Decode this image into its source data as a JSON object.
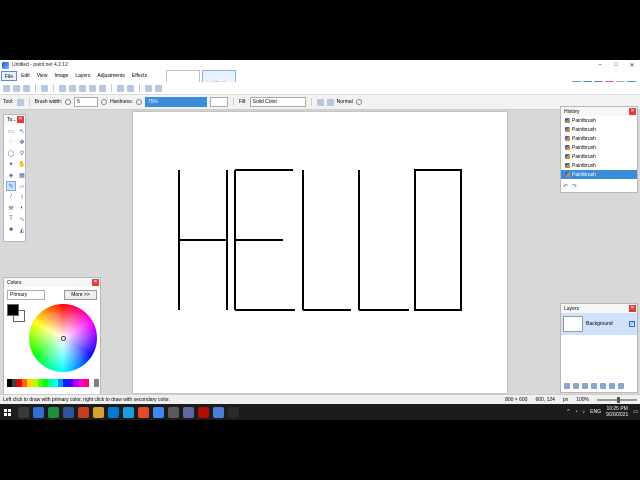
{
  "window": {
    "title": "Untitled - paint.net 4.2.12",
    "controls": [
      "–",
      "□",
      "✕"
    ]
  },
  "menu": [
    "File",
    "Edit",
    "View",
    "Image",
    "Layers",
    "Adjustments",
    "Effects"
  ],
  "thumbnails": [
    "",
    "HELLO"
  ],
  "tool_options": {
    "tool_label": "Tool:",
    "brush_width_label": "Brush width:",
    "brush_width_value": "5",
    "hardness_label": "Hardness:",
    "hardness_value": "75%",
    "fill_label": "Fill:",
    "fill_value": "Solid Color",
    "blend_value": "Normal"
  },
  "tools_panel": {
    "title": "To..."
  },
  "colors_panel": {
    "title": "Colors",
    "mode": "Primary",
    "more_button": "More >>",
    "primary_color": "#000000",
    "secondary_color": "#ffffff"
  },
  "history_panel": {
    "title": "History",
    "items": [
      "Paintbrush",
      "Paintbrush",
      "Paintbrush",
      "Paintbrush",
      "Paintbrush",
      "Paintbrush",
      "Paintbrush"
    ],
    "selected_index": 6
  },
  "layers_panel": {
    "title": "Layers",
    "layer_name": "Background",
    "layer_visible": true
  },
  "canvas": {
    "drawn_text": "HELLO"
  },
  "statusbar": {
    "hint": "Left click to draw with primary color, right click to draw with secondary color.",
    "image_size": "800 × 600",
    "cursor_pos": "600, 124",
    "units": "px",
    "zoom": "100%"
  },
  "taskbar": {
    "language": "ENG",
    "time": "10:25 PM",
    "date": "9/20/2021"
  }
}
